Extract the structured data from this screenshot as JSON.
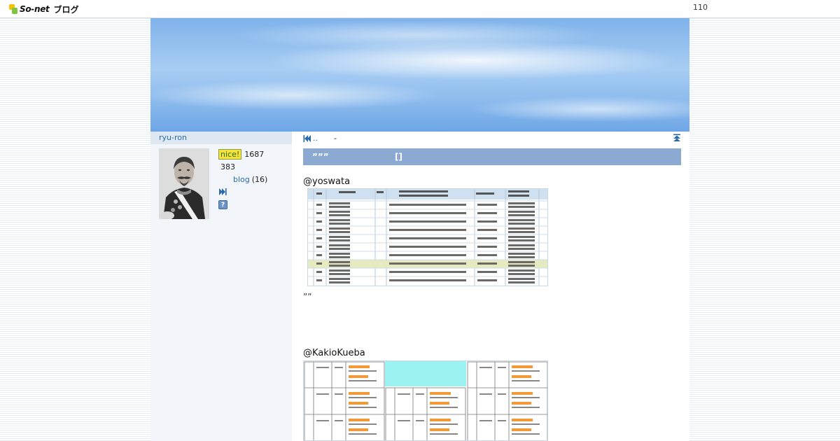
{
  "topbar": {
    "brand": "So-net",
    "service": "ブログ",
    "counter": "110"
  },
  "sidebar": {
    "owner_name": "ryu-ron",
    "nice_badge": "nice!",
    "nice_count": "1687",
    "stat_count": "383",
    "blog_link": "blog",
    "blog_count": "(16)"
  },
  "main": {
    "nav": {
      "prev_label": "..",
      "separator": "-"
    },
    "article": {
      "title_left": "”””",
      "title_right": "[]"
    },
    "posts": [
      {
        "handle": "@yoswata",
        "image_desc": "registry-status-table-screenshot"
      },
      {
        "handle": "@KakioKueba",
        "image_desc": "document-grid-screenshot"
      }
    ],
    "quote_marks": "””"
  },
  "icons": [
    "first-page-icon",
    "back-to-top-icon",
    "next-page-icon",
    "help-icon"
  ],
  "colors": {
    "link": "#2a6aab",
    "title_bar": "#8ba9d1",
    "nice_badge_bg": "#f5e23a",
    "banner_sky": "#8fbdee"
  }
}
